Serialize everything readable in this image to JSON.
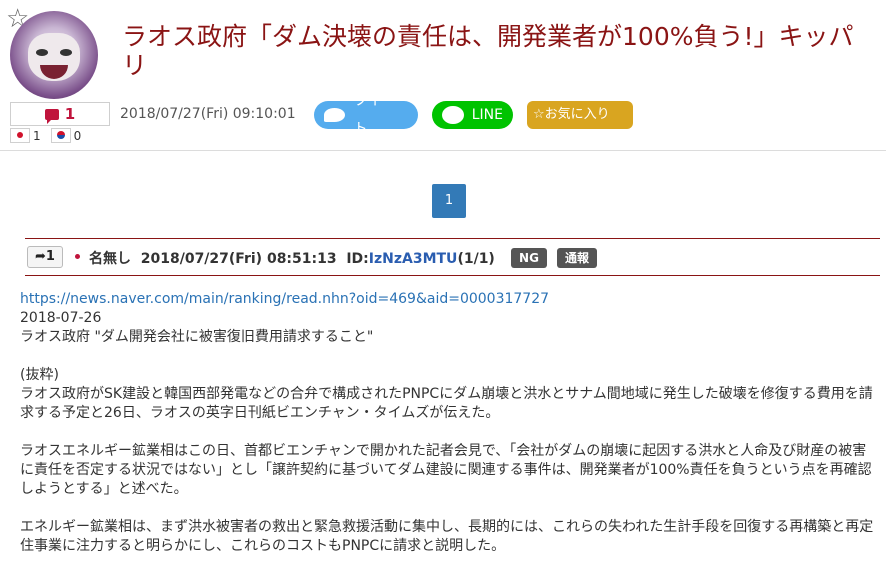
{
  "article": {
    "title": "ラオス政府「ダム決壊の責任は、開発業者が100%負う!」キッパリ",
    "date": "2018/07/27(Fri) 09:10:01",
    "res_count": "1",
    "flag_jp_count": "1",
    "flag_kr_count": "0"
  },
  "share": {
    "tweet": "ツイート",
    "line": "LINE",
    "favorite": "☆お気に入り"
  },
  "pagination": {
    "pages": [
      "1"
    ]
  },
  "post": {
    "number": "1",
    "name": "名無し",
    "datetime": "2018/07/27(Fri) 08:51:13",
    "id_label": "ID:",
    "id_value": "IzNzA3MTU",
    "id_count": "(1/1)",
    "tag_ng": "NG",
    "tag_report": "通報",
    "body": {
      "link": "https://news.naver.com/main/ranking/read.nhn?oid=469&aid=0000317727",
      "date": "2018-07-26",
      "headline": "ラオス政府 \"ダム開発会社に被害復旧費用請求すること\"",
      "excerpt_label": "(抜粋)",
      "para1_line1": "ラオス政府がSK建設と韓国西部発電などの合弁で構成されたPNPCにダム崩壊と洪水とサナム間地域に発生した破壊を修復する費用を請",
      "para1_line2": "求する予定と26日、ラオスの英字日刊紙ビエンチャン・タイムズが伝えた。",
      "para2_line1": "ラオスエネルギー鉱業相はこの日、首都ビエンチャンで開かれた記者会見で、「会社がダムの崩壊に起因する洪水と人命及び財産の被害",
      "para2_line2": "に責任を否定する状況ではない」とし「譲許契約に基づいてダム建設に関連する事件は、開発業者が100%責任を負うという点を再確認",
      "para2_line3": "しようとする」と述べた。",
      "para3_line1": "エネルギー鉱業相は、まず洪水被害者の救出と緊急救援活動に集中し、長期的には、これらの失われた生計手段を回復する再構築と再定",
      "para3_line2": "住事業に注力すると明らかにし、これらのコストもPNPCに請求と説明した。"
    }
  },
  "colors": {
    "title": "#8a1414",
    "tweet": "#55acee",
    "line": "#00c300",
    "favorite": "#d9a520",
    "pager": "#337ab7",
    "tag": "#555555",
    "link": "#2a72b5"
  },
  "icons": [
    "star-icon",
    "comment-icon",
    "japan-flag-icon",
    "korea-flag-icon",
    "twitter-bird-icon",
    "line-icon",
    "share-arrow-icon"
  ]
}
